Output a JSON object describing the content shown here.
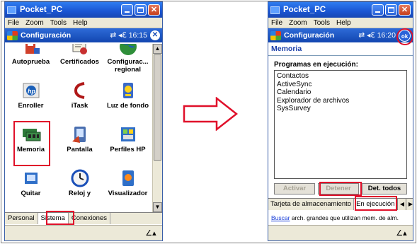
{
  "left": {
    "window_title": "Pocket_PC",
    "menu": [
      "File",
      "Zoom",
      "Tools",
      "Help"
    ],
    "nav_title": "Configuración",
    "nav_status": "⇄ ◂ℇ 16:15",
    "icons": [
      {
        "label": "Autoprueba",
        "icon": "self-test-icon"
      },
      {
        "label": "Certificados",
        "icon": "certificates-icon"
      },
      {
        "label": "Configurac... regional",
        "icon": "globe-icon"
      },
      {
        "label": "Enroller",
        "icon": "hp-enroller-icon"
      },
      {
        "label": "iTask",
        "icon": "itask-icon"
      },
      {
        "label": "Luz de fondo",
        "icon": "backlight-icon"
      },
      {
        "label": "Memoria",
        "icon": "memory-chip-icon"
      },
      {
        "label": "Pantalla",
        "icon": "screen-icon"
      },
      {
        "label": "Perfiles HP",
        "icon": "hp-profiles-icon"
      },
      {
        "label": "Quitar",
        "icon": "remove-programs-icon"
      },
      {
        "label": "Reloj y",
        "icon": "clock-icon"
      },
      {
        "label": "Visualizador",
        "icon": "viewer-icon"
      }
    ],
    "tabs": [
      "Personal",
      "Sistema",
      "Conexiones"
    ],
    "sip_glyph": "∠▴"
  },
  "right": {
    "window_title": "Pocket_PC",
    "menu": [
      "File",
      "Zoom",
      "Tools",
      "Help"
    ],
    "nav_title": "Configuración",
    "nav_status": "⇄ ◂ℇ 16:20",
    "ok_label": "ok",
    "section_title": "Memoria",
    "programs_label": "Programas en ejecución:",
    "programs": [
      "Contactos",
      "ActiveSync",
      "Calendario",
      "Explorador de archivos",
      "SysSurvey"
    ],
    "buttons": {
      "activate": "Activar",
      "stop": "Detener",
      "stop_all": "Det. todos"
    },
    "tabs": [
      "Tarjeta de almacenamiento",
      "En ejecución"
    ],
    "hint_link": "Buscar",
    "hint_text": " arch. grandes que utilizan mem. de alm.",
    "sip_glyph": "∠▴"
  },
  "colors": {
    "highlight": "#e0102a",
    "titlebar": "#1a55d2",
    "link": "#1a3fd8"
  }
}
